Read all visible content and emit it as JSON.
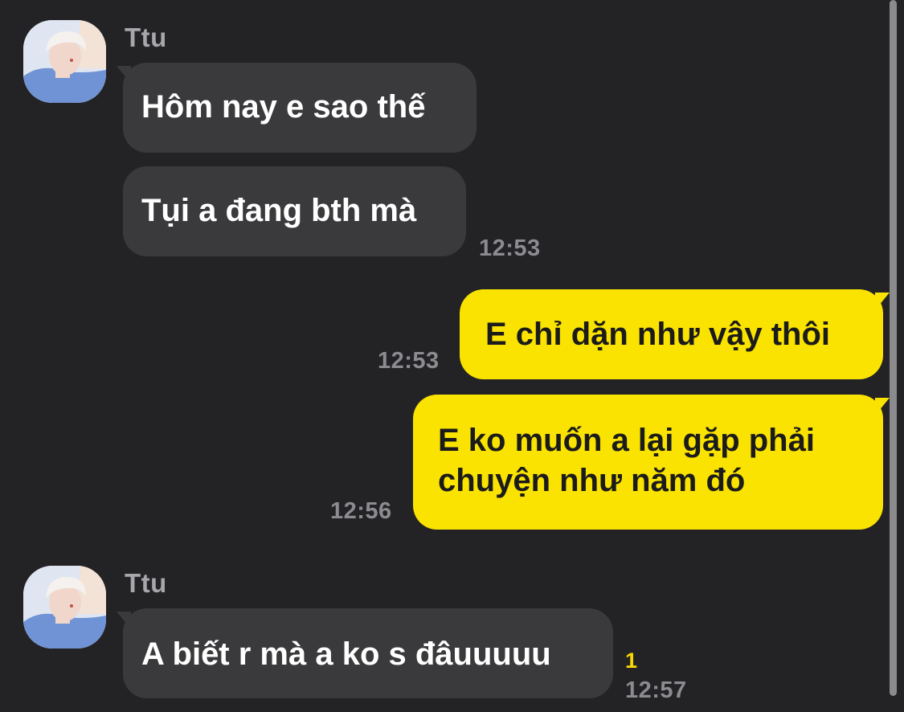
{
  "conversation": {
    "messages": [
      {
        "sender": "Ttu",
        "text": "Hôm nay e sao thế"
      },
      {
        "text": "Tụi a đang bth mà",
        "time": "12:53"
      },
      {
        "text": "E chỉ dặn như vậy thôi",
        "time": "12:53"
      },
      {
        "line1": "E ko muốn a lại gặp phải",
        "line2": "chuyện như năm đó",
        "time": "12:56"
      },
      {
        "sender": "Ttu",
        "text": "A biết r mà a ko s đâuuuuu",
        "unread": "1",
        "time": "12:57"
      }
    ]
  },
  "colors": {
    "background": "#232326",
    "incoming_bubble": "#3a3a3c",
    "outgoing_bubble": "#fae300"
  },
  "icons": {
    "avatar": "profile-photo"
  }
}
